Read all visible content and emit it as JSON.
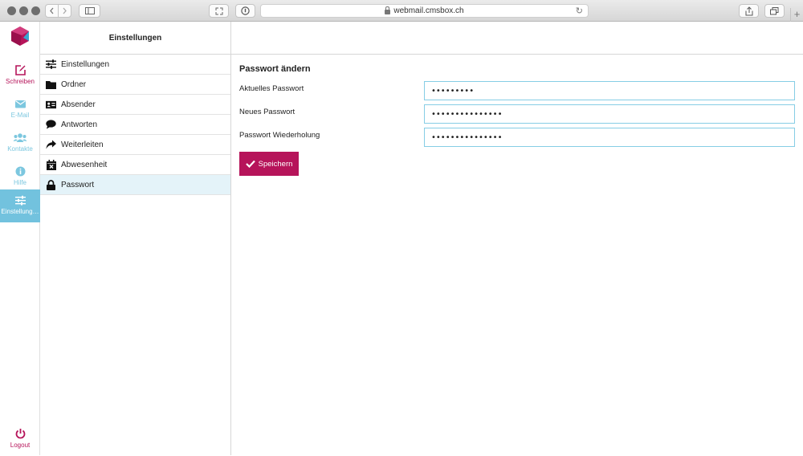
{
  "browser": {
    "url": "webmail.cmsbox.ch"
  },
  "rail": {
    "items": [
      {
        "label": "Schreiben",
        "icon": "compose-icon"
      },
      {
        "label": "E-Mail",
        "icon": "envelope-icon"
      },
      {
        "label": "Kontakte",
        "icon": "contacts-icon"
      },
      {
        "label": "Hilfe",
        "icon": "info-icon"
      },
      {
        "label": "Einstellung…",
        "icon": "sliders-icon"
      }
    ],
    "logout": "Logout"
  },
  "settings": {
    "title": "Einstellungen",
    "items": [
      {
        "label": "Einstellungen",
        "icon": "sliders-icon"
      },
      {
        "label": "Ordner",
        "icon": "folder-icon"
      },
      {
        "label": "Absender",
        "icon": "id-card-icon"
      },
      {
        "label": "Antworten",
        "icon": "speech-bubble-icon"
      },
      {
        "label": "Weiterleiten",
        "icon": "forward-arrow-icon"
      },
      {
        "label": "Abwesenheit",
        "icon": "calendar-x-icon"
      },
      {
        "label": "Passwort",
        "icon": "lock-icon"
      }
    ],
    "active": "Passwort"
  },
  "form": {
    "title": "Passwort ändern",
    "current_label": "Aktuelles Passwort",
    "current_value": "•••••••••",
    "new_label": "Neues Passwort",
    "new_value": "•••••••••••••••",
    "repeat_label": "Passwort Wiederholung",
    "repeat_value": "•••••••••••••••",
    "save_label": "Speichern"
  },
  "colors": {
    "brand": "#b6145a",
    "accent": "#72c2de",
    "input_border": "#86cde5",
    "active_row": "#e4f3f9"
  }
}
